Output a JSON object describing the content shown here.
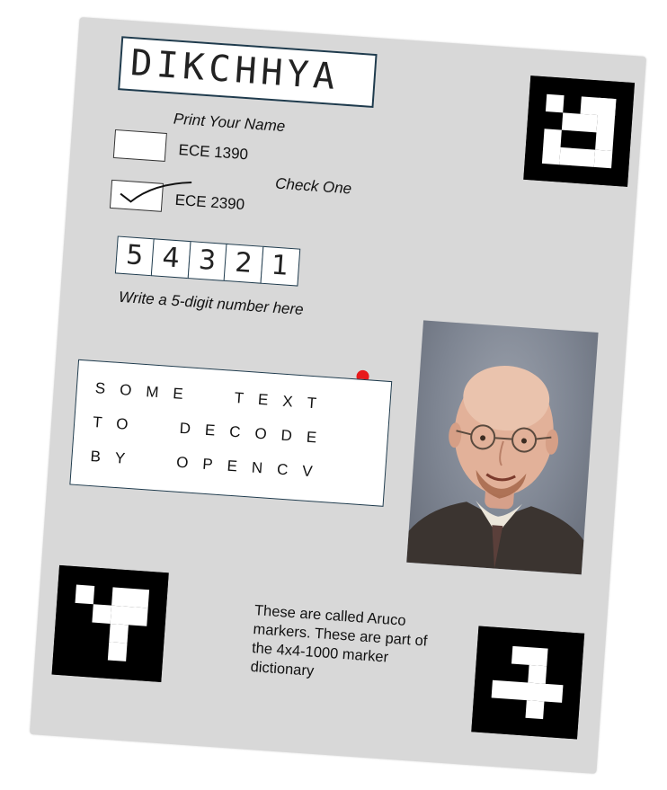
{
  "form": {
    "name_value": "DIKCHHYA",
    "name_caption": "Print Your Name",
    "courses": [
      {
        "label": "ECE 1390",
        "checked": false
      },
      {
        "label": "ECE 2390",
        "checked": true
      }
    ],
    "check_caption": "Check One",
    "digits": [
      "5",
      "4",
      "3",
      "2",
      "1"
    ],
    "digits_caption": "Write a 5-digit number here"
  },
  "ocr_text": {
    "lines": [
      "SOME  TEXT",
      "TO  DECODE",
      "BY  OPENCV"
    ]
  },
  "marker_note": {
    "text": "These are called Aruco markers. These are part of the 4x4-1000 marker dictionary"
  },
  "colors": {
    "sheet": "#d8d8d8",
    "box_border": "#1f3b4d",
    "dot": "#e8191b"
  },
  "icons": {
    "portrait": "man-portrait-photo",
    "markers": [
      "aruco-marker-top-right",
      "aruco-marker-bottom-left",
      "aruco-marker-bottom-right"
    ]
  }
}
